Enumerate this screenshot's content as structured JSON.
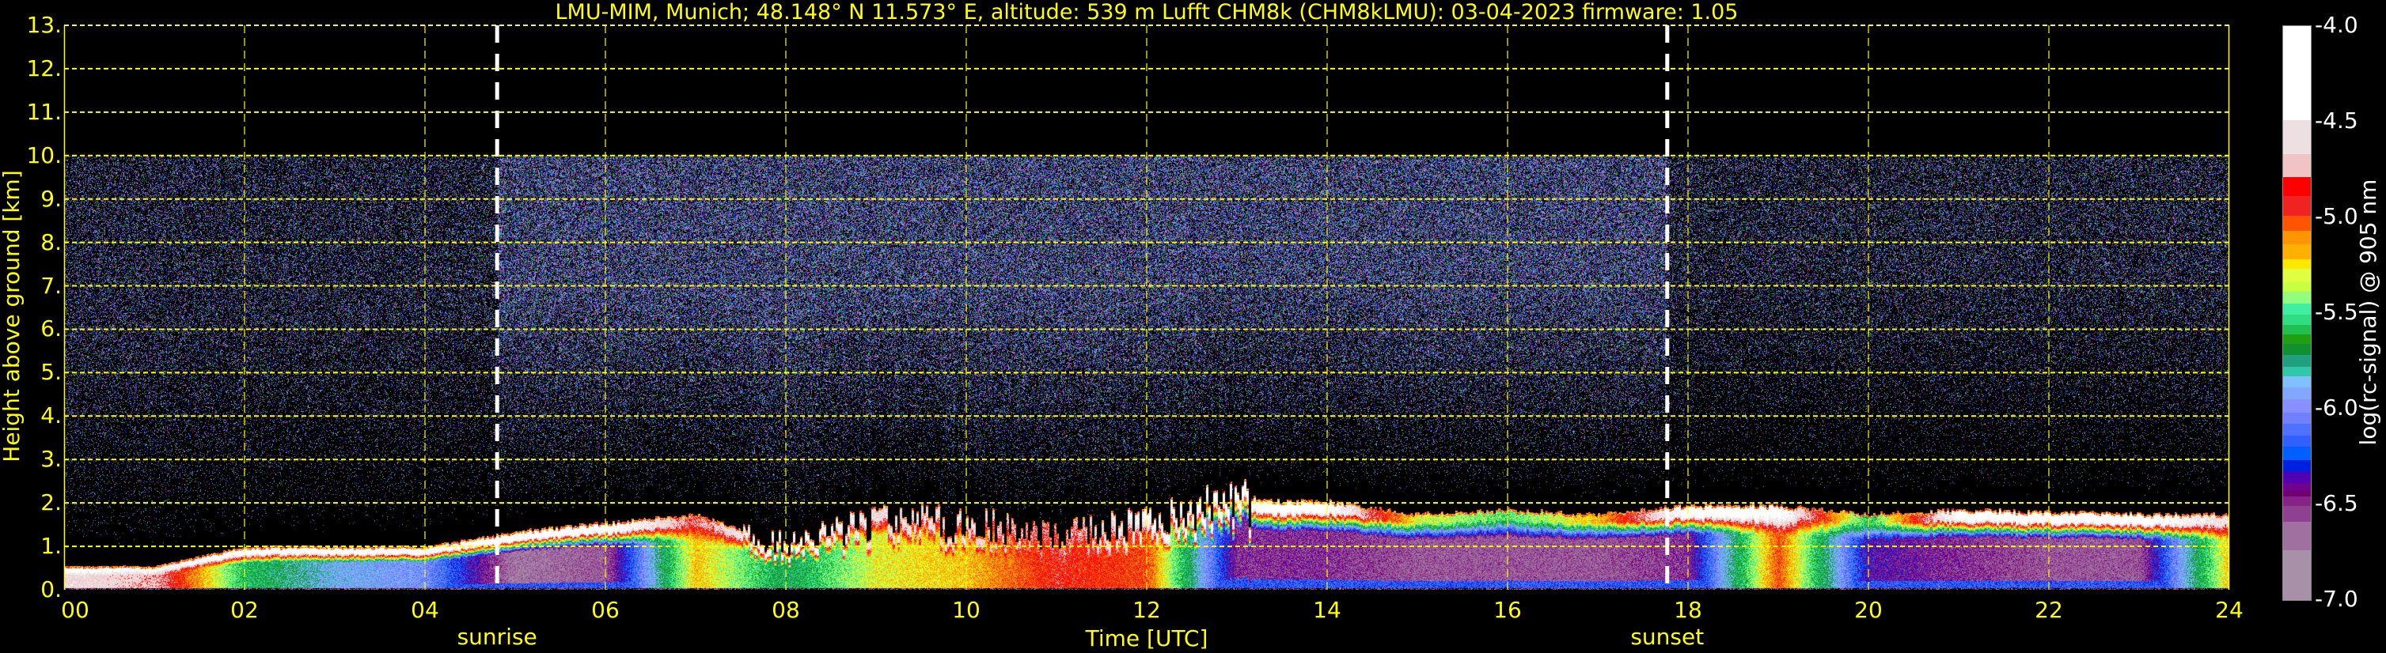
{
  "title": "LMU-MIM, Munich; 48.148° N 11.573° E, altitude: 539 m    Lufft CHM8k (CHM8kLMU): 03-04-2023    firmware: 1.05",
  "chart_data": {
    "type": "heatmap",
    "xlabel": "Time [UTC]",
    "ylabel": "Height above ground [km]",
    "xlim": [
      0,
      24
    ],
    "ylim": [
      0,
      13
    ],
    "x_ticks": [
      "00",
      "02",
      "04",
      "06",
      "08",
      "10",
      "12",
      "14",
      "16",
      "18",
      "20",
      "22",
      "24"
    ],
    "y_ticks": [
      "0.",
      "1.",
      "2.",
      "3.",
      "4.",
      "5.",
      "6.",
      "7.",
      "8.",
      "9.",
      "10.",
      "11.",
      "12.",
      "13."
    ],
    "grid": true,
    "grid_color": "#ffff00",
    "background": "#000000",
    "measurement_top_km": 10,
    "annotations": [
      {
        "label": "sunrise",
        "time_h": 4.8
      },
      {
        "label": "sunset",
        "time_h": 17.77
      }
    ],
    "colorbar": {
      "label": "log(rc-signal) @ 905 nm",
      "range": [
        -7.0,
        -4.0
      ],
      "ticks": [
        "-4.0",
        "-4.5",
        "-5.0",
        "-5.5",
        "-6.0",
        "-6.5",
        "-7.0"
      ],
      "levels": [
        -4.0,
        -4.49,
        -4.67,
        -4.79,
        -4.89,
        -4.99,
        -5.07,
        -5.14,
        -5.22,
        -5.27,
        -5.34,
        -5.39,
        -5.45,
        -5.51,
        -5.56,
        -5.61,
        -5.66,
        -5.72,
        -5.78,
        -5.83,
        -5.89,
        -5.95,
        -6.02,
        -6.08,
        -6.14,
        -6.2,
        -6.27,
        -6.33,
        -6.39,
        -6.43,
        -6.46,
        -6.51,
        -6.59,
        -6.74,
        -7.0
      ],
      "colors": [
        "#ffffff",
        "#ece0e2",
        "#f0c4c4",
        "#ff0000",
        "#f02222",
        "#ff5500",
        "#ff9500",
        "#ffb000",
        "#ffe800",
        "#e0ff40",
        "#c8ff40",
        "#90ff80",
        "#40f0a0",
        "#30dd80",
        "#20c050",
        "#20a010",
        "#109030",
        "#20a080",
        "#30c8a8",
        "#80c0ff",
        "#80a8ff",
        "#8890ff",
        "#7080ff",
        "#5070ff",
        "#3060ff",
        "#0060ff",
        "#0020e0",
        "#5000b0",
        "#700090",
        "#700070",
        "#882288",
        "#904090",
        "#a070a0",
        "#a890a8"
      ]
    },
    "hours": [
      0,
      1,
      2,
      3,
      4,
      5,
      6,
      7,
      8,
      9,
      10,
      11,
      12,
      13,
      14,
      15,
      16,
      17,
      18,
      19,
      20,
      21,
      22,
      23,
      24
    ],
    "layer_top_km": [
      0.5,
      0.5,
      0.95,
      0.95,
      0.95,
      1.3,
      1.5,
      1.7,
      1.0,
      1.5,
      1.5,
      1.2,
      1.5,
      2.0,
      2.0,
      1.7,
      1.8,
      1.7,
      1.9,
      1.9,
      1.7,
      1.8,
      1.75,
      1.7,
      1.7
    ],
    "layer_top_signal": [
      -4.3,
      -4.4,
      -4.3,
      -4.3,
      -4.3,
      -4.3,
      -4.3,
      -4.8,
      -4.3,
      -4.6,
      -4.6,
      -4.8,
      -4.4,
      -4.3,
      -4.3,
      -5.3,
      -5.5,
      -5.2,
      -4.3,
      -4.3,
      -5.6,
      -4.3,
      -4.3,
      -4.3,
      -4.6
    ],
    "layer_interior_signal": [
      -4.6,
      -4.7,
      -5.6,
      -5.9,
      -6.0,
      -6.7,
      -6.6,
      -5.2,
      -5.7,
      -5.3,
      -5.2,
      -4.9,
      -5.0,
      -6.5,
      -6.5,
      -6.6,
      -6.6,
      -6.6,
      -6.5,
      -5.0,
      -6.4,
      -6.5,
      -6.6,
      -6.6,
      -5.2
    ]
  }
}
